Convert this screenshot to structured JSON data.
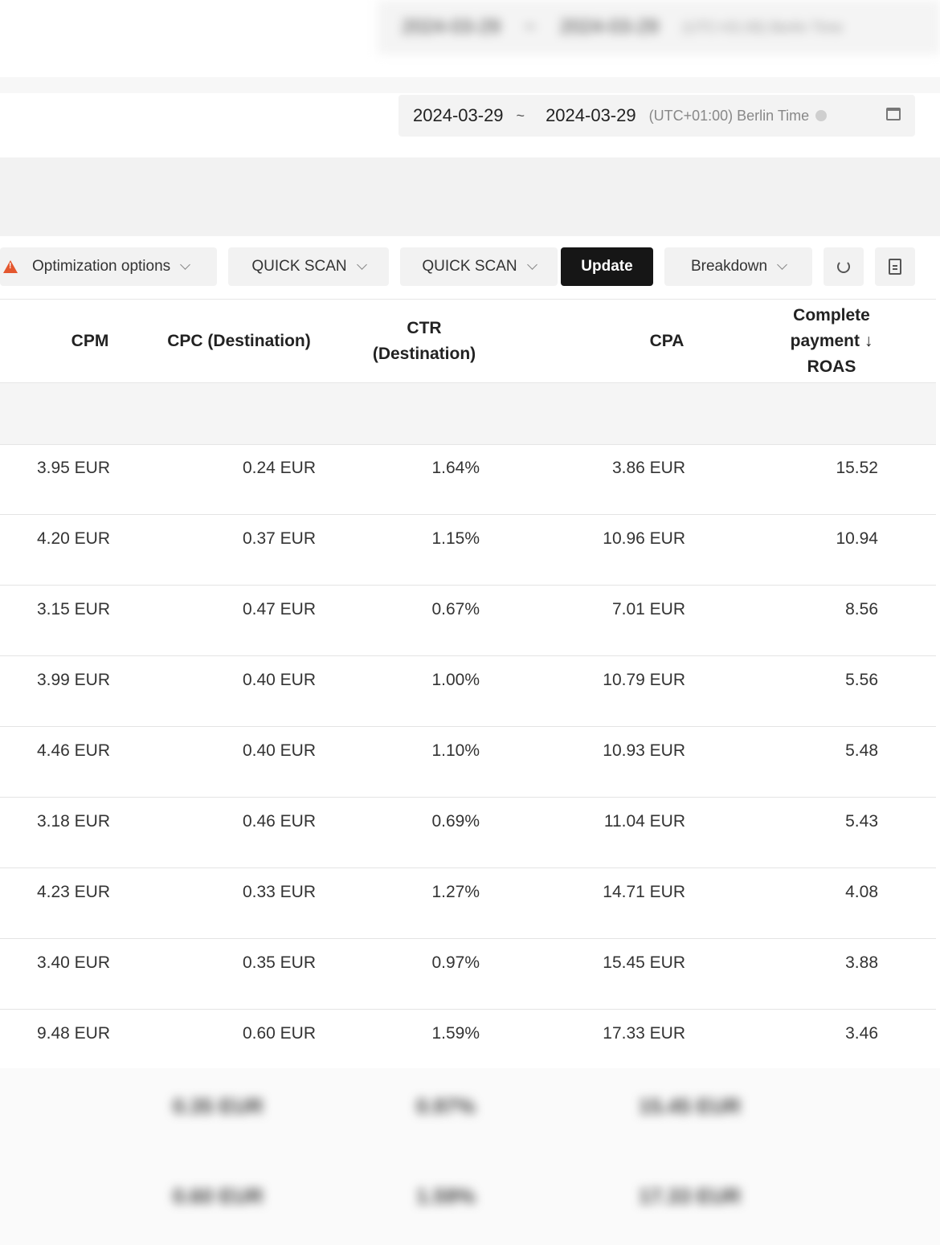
{
  "header": {
    "blurred_start": "2024-03-29",
    "blurred_end": "2024-03-29",
    "blurred_timezone": "(UTC+01:00) Berlin Time",
    "start_date": "2024-03-29",
    "separator": "~",
    "end_date": "2024-03-29",
    "timezone": "(UTC+01:00) Berlin Time"
  },
  "toolbar": {
    "optimization_label": "Optimization options",
    "quick_scan_1": "QUICK SCAN",
    "quick_scan_2": "QUICK SCAN",
    "update_label": "Update",
    "breakdown_label": "Breakdown"
  },
  "table": {
    "headers": {
      "cpm": "CPM",
      "cpc": "CPC (Destination)",
      "ctr_line1": "CTR",
      "ctr_line2": "(Destination)",
      "cpa": "CPA",
      "roas_line1": "Complete",
      "roas_line2": "payment ↓",
      "roas_line3": "ROAS"
    },
    "rows": [
      {
        "cpm": "3.95 EUR",
        "cpc": "0.24 EUR",
        "ctr": "1.64%",
        "cpa": "3.86 EUR",
        "roas": "15.52"
      },
      {
        "cpm": "4.20 EUR",
        "cpc": "0.37 EUR",
        "ctr": "1.15%",
        "cpa": "10.96 EUR",
        "roas": "10.94"
      },
      {
        "cpm": "3.15 EUR",
        "cpc": "0.47 EUR",
        "ctr": "0.67%",
        "cpa": "7.01 EUR",
        "roas": "8.56"
      },
      {
        "cpm": "3.99 EUR",
        "cpc": "0.40 EUR",
        "ctr": "1.00%",
        "cpa": "10.79 EUR",
        "roas": "5.56"
      },
      {
        "cpm": "4.46 EUR",
        "cpc": "0.40 EUR",
        "ctr": "1.10%",
        "cpa": "10.93 EUR",
        "roas": "5.48"
      },
      {
        "cpm": "3.18 EUR",
        "cpc": "0.46 EUR",
        "ctr": "0.69%",
        "cpa": "11.04 EUR",
        "roas": "5.43"
      },
      {
        "cpm": "4.23 EUR",
        "cpc": "0.33 EUR",
        "ctr": "1.27%",
        "cpa": "14.71 EUR",
        "roas": "4.08"
      },
      {
        "cpm": "3.40 EUR",
        "cpc": "0.35 EUR",
        "ctr": "0.97%",
        "cpa": "15.45 EUR",
        "roas": "3.88"
      },
      {
        "cpm": "9.48 EUR",
        "cpc": "0.60 EUR",
        "ctr": "1.59%",
        "cpa": "17.33 EUR",
        "roas": "3.46"
      }
    ],
    "blurred_rows": [
      {
        "cpc": "0.35 EUR",
        "ctr": "0.97%",
        "cpa": "15.45 EUR"
      },
      {
        "cpc": "0.60 EUR",
        "ctr": "1.59%",
        "cpa": "17.33 EUR"
      }
    ]
  }
}
